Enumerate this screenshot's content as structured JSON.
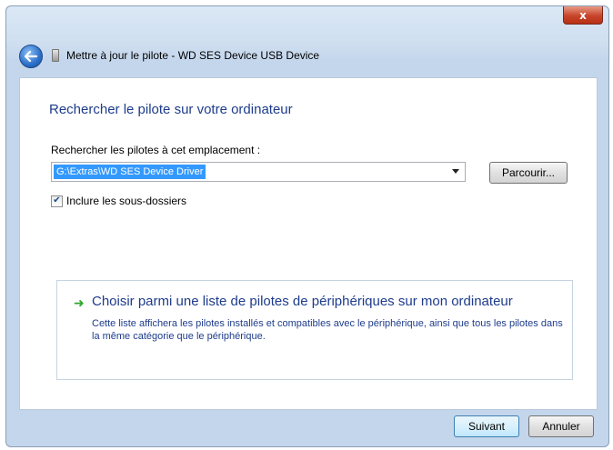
{
  "window": {
    "close_label": "x",
    "title": "Mettre à jour le pilote - WD SES Device USB Device"
  },
  "main": {
    "heading": "Rechercher le pilote sur votre ordinateur",
    "path_label": "Rechercher les pilotes à cet emplacement :",
    "path_value": "G:\\Extras\\WD SES Device Driver",
    "browse_label": "Parcourir...",
    "include_subfolders_label": "Inclure les sous-dossiers",
    "include_subfolders_checked": true
  },
  "option": {
    "title": "Choisir parmi une liste de pilotes de périphériques sur mon ordinateur",
    "description": "Cette liste affichera les pilotes installés et compatibles avec le périphérique, ainsi que tous les pilotes dans la même catégorie que le périphérique."
  },
  "footer": {
    "next_label": "Suivant",
    "cancel_label": "Annuler"
  }
}
